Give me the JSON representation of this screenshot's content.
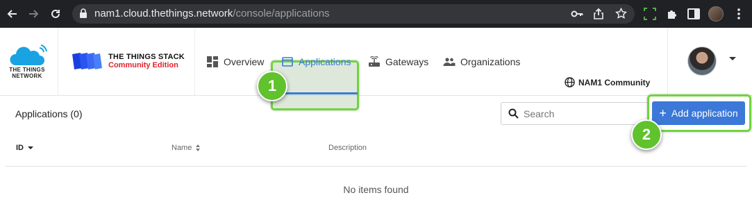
{
  "browser": {
    "url_host": "nam1.cloud.thethings.network",
    "url_path": "/console/applications"
  },
  "brand": {
    "ttn_logo_text": "THE THINGS NETWORK",
    "stack_title": "THE THINGS STACK",
    "stack_subtitle": "Community Edition",
    "accent": "#3b78d8",
    "subtitle_color": "#e4222c"
  },
  "nav": {
    "items": [
      {
        "label": "Overview",
        "icon": "dashboard-icon"
      },
      {
        "label": "Applications",
        "icon": "application-icon",
        "active": true
      },
      {
        "label": "Gateways",
        "icon": "gateway-icon"
      },
      {
        "label": "Organizations",
        "icon": "organization-icon"
      }
    ],
    "community_label": "NAM1 Community"
  },
  "annotations": {
    "step1": "1",
    "step2": "2",
    "highlight_color": "#6fd53c",
    "badge_color": "#60c22c"
  },
  "content": {
    "title": "Applications (0)",
    "search_placeholder": "Search",
    "add_button_label": "Add application",
    "columns": [
      "ID",
      "Name",
      "Description"
    ],
    "empty_text": "No items found"
  }
}
